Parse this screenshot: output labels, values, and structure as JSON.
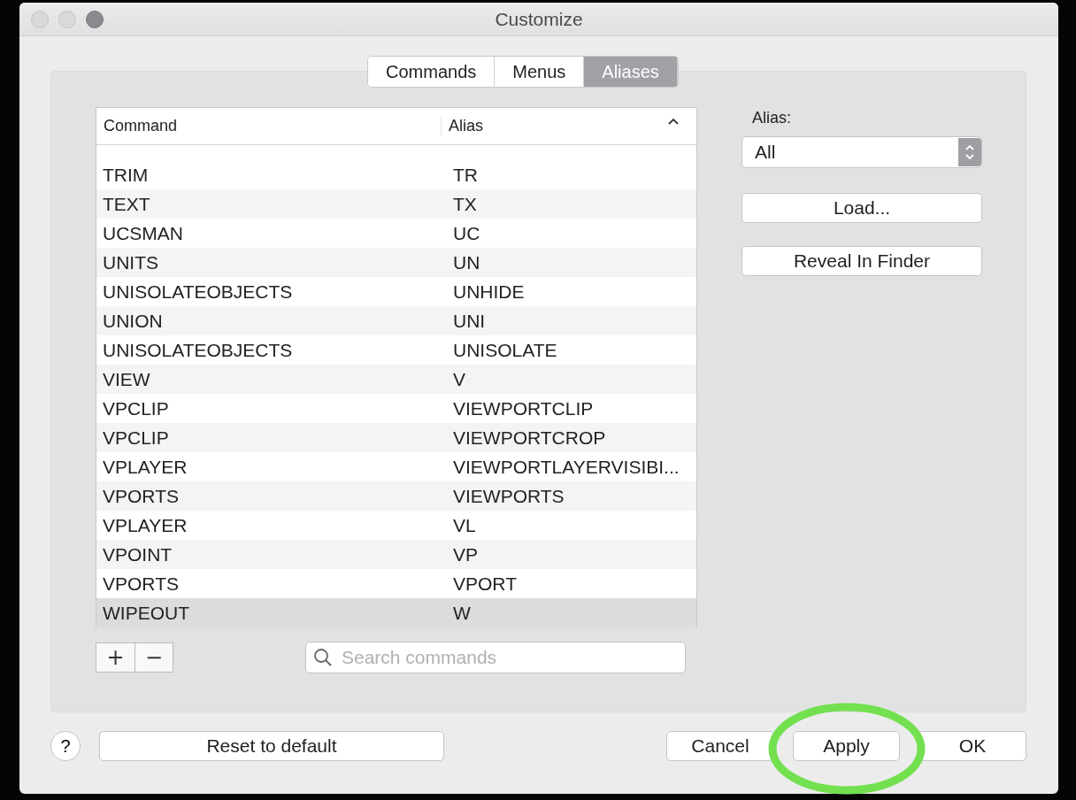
{
  "window": {
    "title": "Customize"
  },
  "tabs": [
    {
      "label": "Commands",
      "selected": false
    },
    {
      "label": "Menus",
      "selected": false
    },
    {
      "label": "Aliases",
      "selected": true
    }
  ],
  "table": {
    "columns": [
      "Command",
      "Alias"
    ],
    "sort_ascending": true,
    "rows": [
      {
        "command": "TRIM",
        "alias": "TR",
        "selected": false
      },
      {
        "command": "TEXT",
        "alias": "TX",
        "selected": false
      },
      {
        "command": "UCSMAN",
        "alias": "UC",
        "selected": false
      },
      {
        "command": "UNITS",
        "alias": "UN",
        "selected": false
      },
      {
        "command": "UNISOLATEOBJECTS",
        "alias": "UNHIDE",
        "selected": false
      },
      {
        "command": "UNION",
        "alias": "UNI",
        "selected": false
      },
      {
        "command": "UNISOLATEOBJECTS",
        "alias": "UNISOLATE",
        "selected": false
      },
      {
        "command": "VIEW",
        "alias": "V",
        "selected": false
      },
      {
        "command": "VPCLIP",
        "alias": "VIEWPORTCLIP",
        "selected": false
      },
      {
        "command": "VPCLIP",
        "alias": "VIEWPORTCROP",
        "selected": false
      },
      {
        "command": "VPLAYER",
        "alias": "VIEWPORTLAYERVISIBI...",
        "selected": false
      },
      {
        "command": "VPORTS",
        "alias": "VIEWPORTS",
        "selected": false
      },
      {
        "command": "VPLAYER",
        "alias": "VL",
        "selected": false
      },
      {
        "command": "VPOINT",
        "alias": "VP",
        "selected": false
      },
      {
        "command": "VPORTS",
        "alias": "VPORT",
        "selected": false
      },
      {
        "command": "WIPEOUT",
        "alias": "W",
        "selected": true
      }
    ]
  },
  "add_remove": [
    "+",
    "−"
  ],
  "search": {
    "placeholder": "Search commands"
  },
  "alias_filter": {
    "label": "Alias:",
    "value": "All"
  },
  "side_buttons": [
    "Load...",
    "Reveal In Finder"
  ],
  "help": "?",
  "reset_button": "Reset to default",
  "buttons": [
    {
      "label": "Cancel",
      "circled": false
    },
    {
      "label": "Apply",
      "circled": true
    },
    {
      "label": "OK",
      "circled": false
    }
  ]
}
